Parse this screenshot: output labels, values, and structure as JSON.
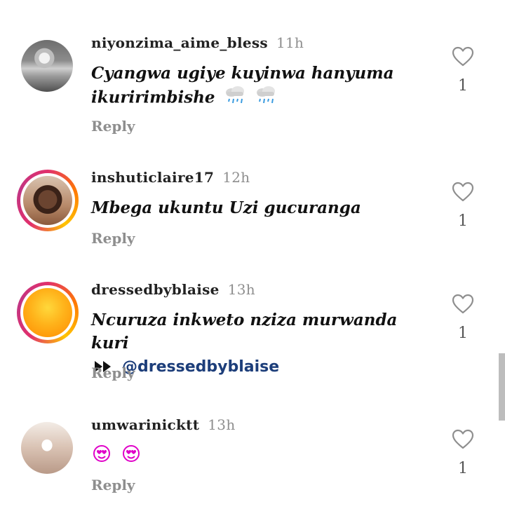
{
  "comments": [
    {
      "username": "niyonzima_aime_bless",
      "time": "11h",
      "text_line1": "Cyangwa ugiye kuyinwa hanyuma",
      "text_line2": "ikuririmbishe",
      "reply_label": "Reply",
      "likes": "1",
      "emoji": "rain-cloud-icon"
    },
    {
      "username": "inshuticlaire17",
      "time": "12h",
      "text_line1": "Mbega ukuntu Uzi gucuranga",
      "reply_label": "Reply",
      "likes": "1"
    },
    {
      "username": "dressedbyblaise",
      "time": "13h",
      "text_line1": "Ncuruza inkweto nziza murwanda kuri",
      "text_line2_mention": "@dressedbyblaise",
      "reply_label": "Reply",
      "likes": "1",
      "prefix_icon": "fast-forward-icon"
    },
    {
      "username": "umwarinicktt",
      "time": "13h",
      "reply_label": "Reply",
      "likes": "1",
      "emoji": "heart-eyes-icon"
    }
  ],
  "colors": {
    "mention": "#1d3e7a",
    "secondary_text": "#8e8e8e",
    "heart_emoji": "#e000c8"
  }
}
